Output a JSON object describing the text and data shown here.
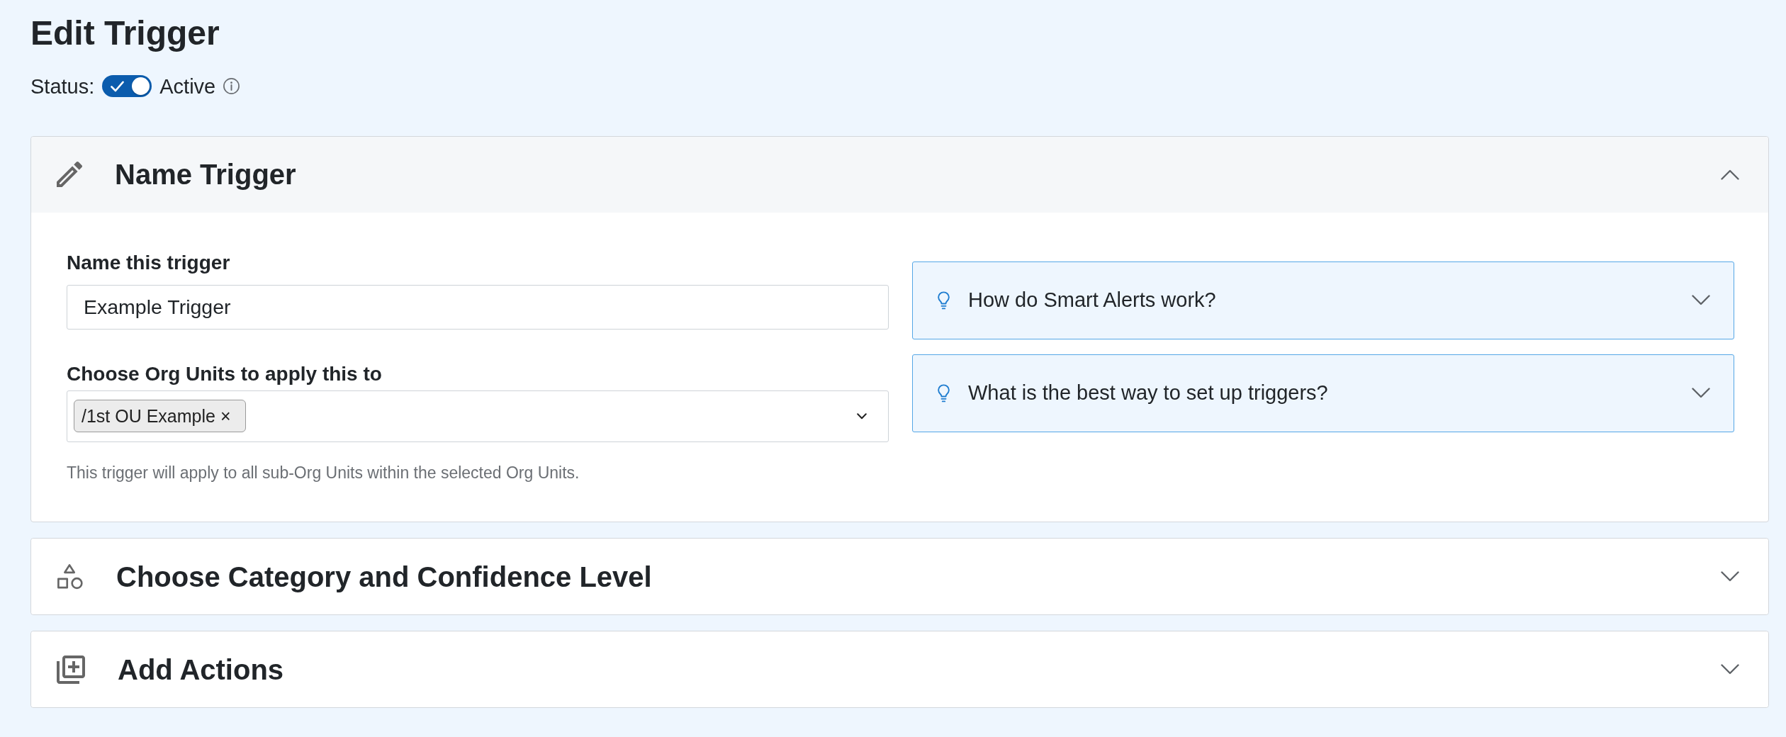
{
  "page": {
    "title": "Edit Trigger"
  },
  "status": {
    "label": "Status:",
    "on": true,
    "value": "Active"
  },
  "sections": [
    {
      "title": "Name Trigger",
      "expanded": true,
      "name_field": {
        "label": "Name this trigger",
        "value": "Example Trigger"
      },
      "org_units_field": {
        "label": "Choose Org Units to apply this to",
        "tags": [
          {
            "text": "/1st OU Example",
            "remove": "×"
          }
        ],
        "help": "This trigger will apply to all sub-Org Units within the selected Org Units."
      },
      "help_panels": [
        {
          "question": "How do Smart Alerts work?",
          "expanded": false
        },
        {
          "question": "What is the best way to set up triggers?",
          "expanded": false
        }
      ]
    },
    {
      "title": "Choose Category and Confidence Level",
      "expanded": false
    },
    {
      "title": "Add Actions",
      "expanded": false
    }
  ]
}
